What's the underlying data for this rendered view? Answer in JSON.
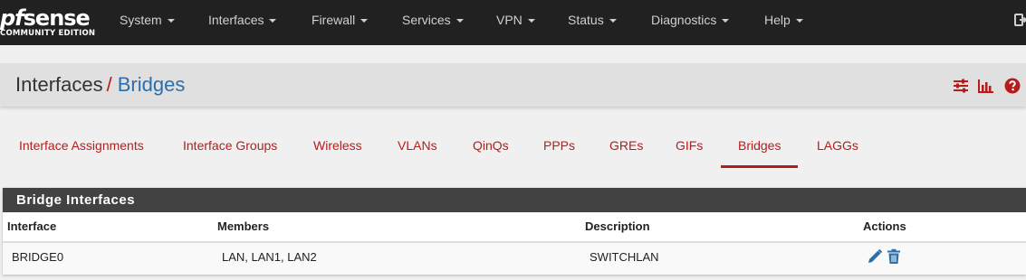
{
  "brand": {
    "logo_text_pf": "pf",
    "logo_text_sense": "sense",
    "logo_edition": "COMMUNITY EDITION"
  },
  "nav": {
    "items": [
      {
        "label": "System"
      },
      {
        "label": "Interfaces"
      },
      {
        "label": "Firewall"
      },
      {
        "label": "Services"
      },
      {
        "label": "VPN"
      },
      {
        "label": "Status"
      },
      {
        "label": "Diagnostics"
      },
      {
        "label": "Help"
      }
    ],
    "logout_icon": "logout-icon"
  },
  "breadcrumb": {
    "parent": "Interfaces",
    "separator": "/",
    "current": "Bridges"
  },
  "header_icons": [
    "sliders-icon",
    "bar-chart-icon",
    "question-circle-icon"
  ],
  "colors": {
    "navbar": "#212121",
    "accent_red": "#b71c1c",
    "link_blue": "#2c6fa8",
    "panel_heading": "#424242"
  },
  "tabs": [
    {
      "label": "Interface Assignments",
      "active": false
    },
    {
      "label": "Interface Groups",
      "active": false
    },
    {
      "label": "Wireless",
      "active": false
    },
    {
      "label": "VLANs",
      "active": false
    },
    {
      "label": "QinQs",
      "active": false
    },
    {
      "label": "PPPs",
      "active": false
    },
    {
      "label": "GREs",
      "active": false
    },
    {
      "label": "GIFs",
      "active": false
    },
    {
      "label": "Bridges",
      "active": true
    },
    {
      "label": "LAGGs",
      "active": false
    }
  ],
  "panel": {
    "title": "Bridge Interfaces",
    "columns": [
      "Interface",
      "Members",
      "Description",
      "Actions"
    ],
    "rows": [
      {
        "interface": "BRIDGE0",
        "members": "LAN, LAN1, LAN2",
        "description": "SWITCHLAN",
        "actions": [
          "edit-pencil-icon",
          "delete-trash-icon"
        ]
      }
    ]
  }
}
